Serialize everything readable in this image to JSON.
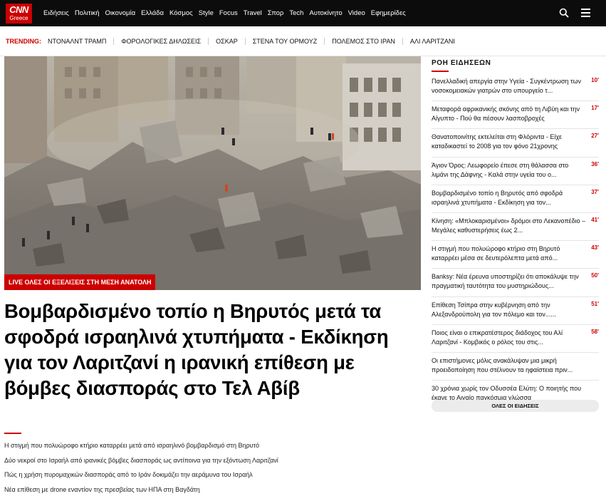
{
  "brand": {
    "logo_main": "CNN",
    "logo_sub": "Greece"
  },
  "nav": {
    "items": [
      "Ειδήσεις",
      "Πολιτική",
      "Οικονομία",
      "Ελλάδα",
      "Κόσμος",
      "Style",
      "Focus",
      "Travel",
      "Σπορ",
      "Tech",
      "Αυτοκίνητο",
      "Video",
      "Εφημερίδες"
    ],
    "search_icon": "search-icon",
    "menu_icon": "hamburger-menu-icon"
  },
  "trending": {
    "label": "TRENDING:",
    "items": [
      "ΝΤΟΝΑΛΝΤ ΤΡΑΜΠ",
      "ΦΟΡΟΛΟΓΙΚΕΣ ΔΗΛΩΣΕΙΣ",
      "ΟΣΚΑΡ",
      "ΣΤΕΝΑ ΤΟΥ ΟΡΜΟΥΖ",
      "ΠΟΛΕΜΟΣ ΣΤΟ ΙΡΑΝ",
      "ΑΛΙ ΛΑΡΙΤΖΑΝΙ"
    ]
  },
  "hero": {
    "badge": "LIVE ΟΛΕΣ ΟΙ ΕΞΕΛΙΞΕΙΣ ΣΤΗ ΜΕΣΗ ΑΝΑΤΟΛΗ",
    "headline": "Βομβαρδισμένο τοπίο η Βηρυτός μετά τα σφοδρά ισραηλινά χτυπήματα - Εκδίκηση για τον Λαριτζανί η ιρανική επίθεση με βόμβες διασποράς στο Τελ Αβίβ",
    "related": [
      "Η στιγμή που πολυώροφο κτήριο καταρρέει μετά από ισραηλινό βομβαρδισμό στη Βηρυτό",
      "Δύο νεκροί στο Ισραήλ από ιρανικές βόμβες διασποράς ως αντίποινα για την εξόντωση Λαριτζανί",
      "Πώς η χρήση πυρομαχικών διασποράς από το Ιράν δοκιμάζει την αεράμυνα του Ισραήλ",
      "Νέα επίθεση με drone εναντίον της πρεσβείας των ΗΠΑ στη Βαγδάτη"
    ]
  },
  "feed": {
    "title": "ΡΟΗ ΕΙΔΗΣΕΩΝ",
    "items": [
      {
        "text": "Πανελλαδική απεργία στην Υγεία - Συγκέντρωση των νοσοκομειακών γιατρών στο υπουργείο τ...",
        "time": "10'"
      },
      {
        "text": "Μεταφορά αφρικανικής σκόνης από τη Λιβύη και την Αίγυπτο - Πού θα πέσουν λασποβροχές",
        "time": "17'"
      },
      {
        "text": "Θανατοποινίτης εκτελείται στη Φλόριντα - Είχε καταδικαστεί το 2008 για τον φόνο 21χρονης",
        "time": "27'"
      },
      {
        "text": "Άγιον Όρος: Λεωφορείο έπεσε στη θάλασσα στο λιμάνι της Δάφνης - Καλά στην υγεία του ο...",
        "time": "36'"
      },
      {
        "text": "Βομβαρδισμένο τοπίο η Βηρυτός από σφοδρά ισραηλινά χτυπήματα - Εκδίκηση για τον...",
        "time": "37'"
      },
      {
        "text": "Κίνηση: «Μπλοκαρισμένοι» δρόμοι στο Λεκανοπέδιο – Μεγάλες καθυστερήσεις έως 2...",
        "time": "41'"
      },
      {
        "text": "Η στιγμή που πολυώροφο κτήριο στη Βηρυτό καταρρέει μέσα σε δευτερόλεπτα μετά από...",
        "time": "43'"
      },
      {
        "text": "Banksy: Νέα έρευνα υποστηρίζει ότι αποκάλυψε την πραγματική ταυτότητα του μυστηριώδους...",
        "time": "50'"
      },
      {
        "text": "Επίθεση Τσίπρα στην κυβέρνηση από την Αλεξανδρούπολη για τον πόλεμο και τον......",
        "time": "51'"
      },
      {
        "text": "Ποιος είναι ο επικρατέστερος διάδοχος του Αλί Λαριτζανί - Κομβικός ο ρόλος του στις...",
        "time": "58'"
      },
      {
        "text": "Οι επιστήμονες μόλις ανακάλυψαν μια μικρή προειδοποίηση που στέλνουν τα ηφαίστεια πριν...",
        "time": ""
      },
      {
        "text": "30 χρόνια χωρίς τον Οδυσσέα Ελύτη: Ο ποιητής που έκανε το Αιγαίο παγκόσμια γλώσσα",
        "time": ""
      }
    ],
    "all_button": "ΟΛΕΣ ΟΙ ΕΙΔΗΣΕΙΣ"
  }
}
